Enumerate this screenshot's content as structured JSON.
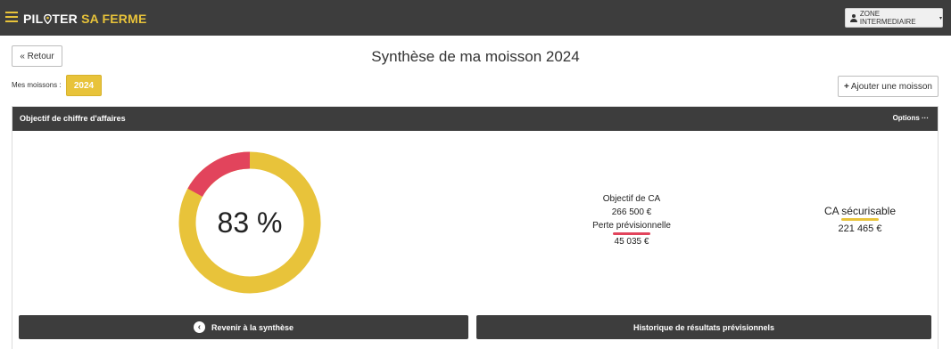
{
  "header": {
    "brand_part1": "PIL",
    "brand_part2": "TER",
    "brand_part3": "SA FERME",
    "zone_label": "ZONE INTERMEDIAIRE",
    "accent_color": "#e8c33a"
  },
  "nav": {
    "back_label": "« Retour",
    "page_title": "Synthèse de ma moisson 2024"
  },
  "harvests": {
    "label": "Mes moissons :",
    "selected_year": "2024",
    "add_label": "Ajouter une moisson"
  },
  "panel": {
    "title": "Objectif de chiffre d'affaires",
    "options_label": "Options ···",
    "progress_percent": 83,
    "progress_label": "83 %",
    "revenue_target_label": "Objectif de CA",
    "revenue_target_value": "266 500 €",
    "forecast_loss_label": "Perte prévisionnelle",
    "forecast_loss_value": "45 035 €",
    "securable_label": "CA sécurisable",
    "securable_value": "221 465 €",
    "colors": {
      "achieved": "#e8c33a",
      "loss": "#e2445c"
    }
  },
  "footer": {
    "back_synthesis_label": "Revenir à la synthèse",
    "history_label": "Historique de résultats prévisionnels"
  }
}
